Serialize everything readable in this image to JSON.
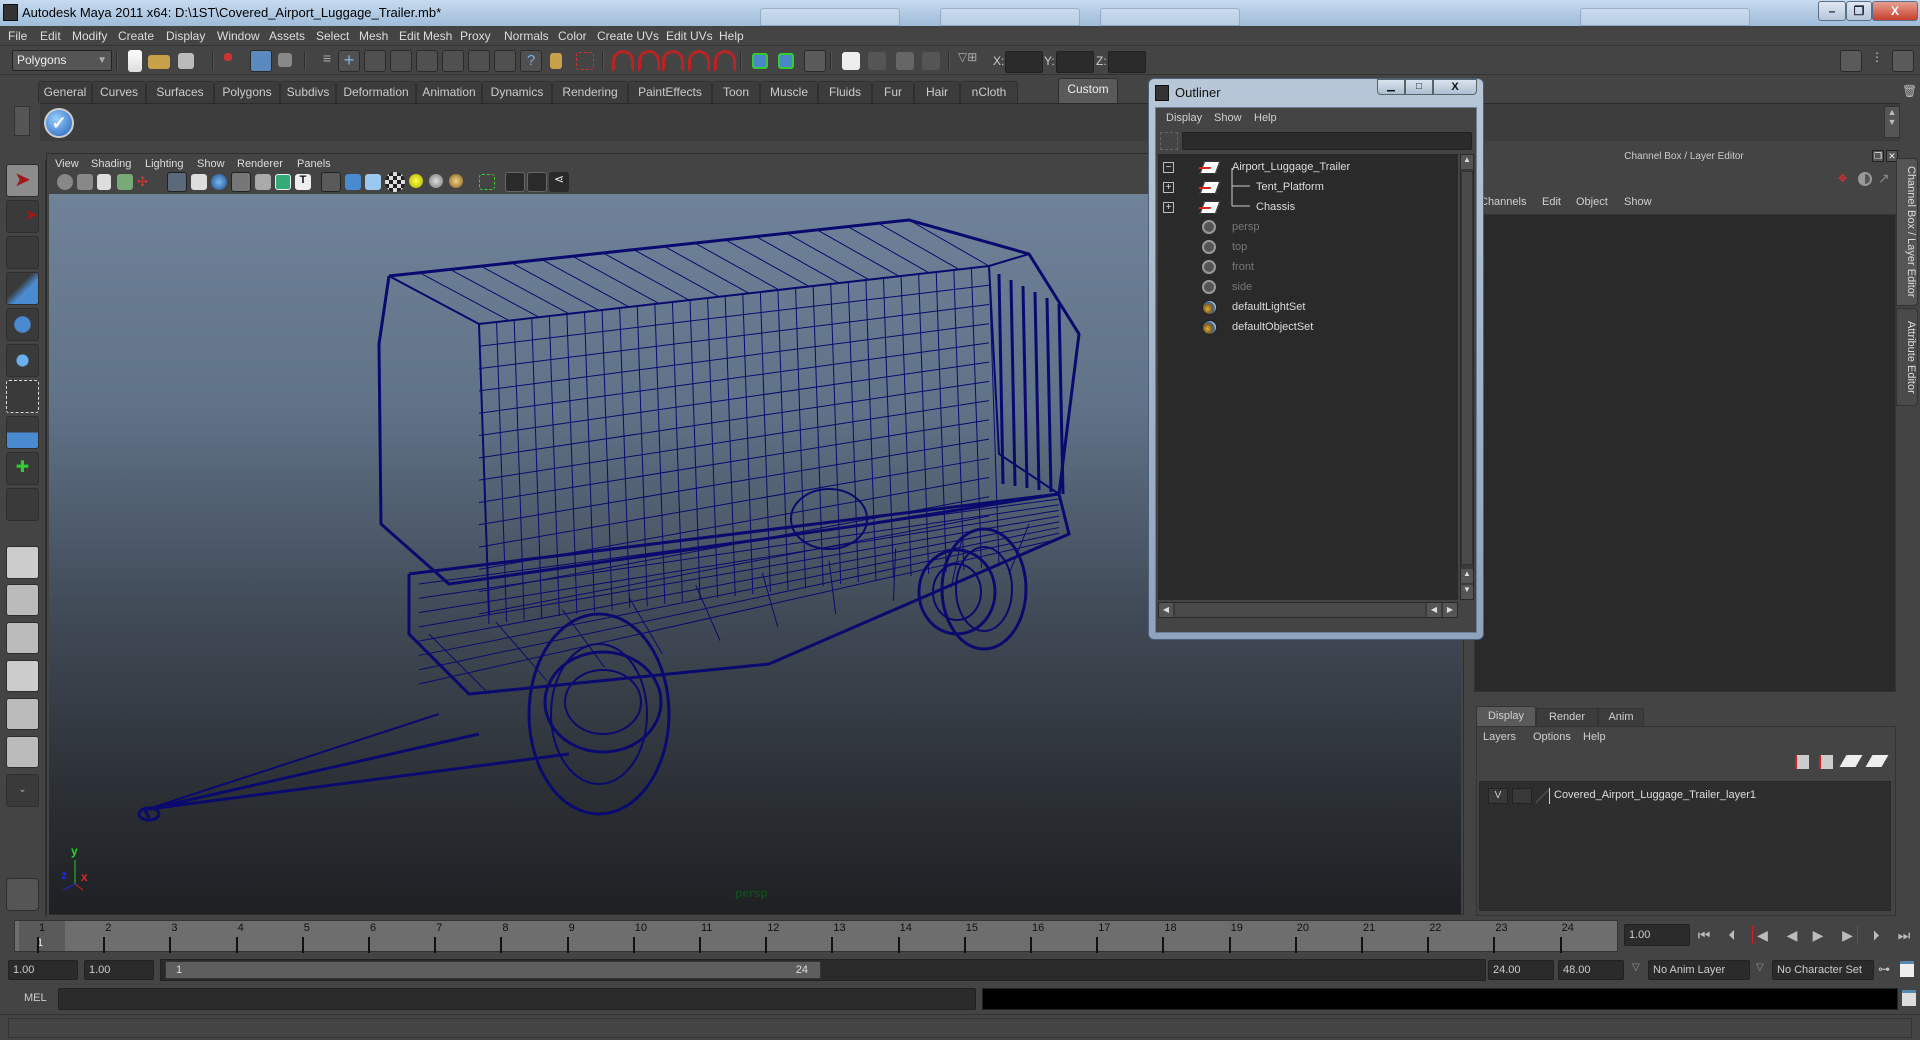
{
  "window": {
    "title": "Autodesk Maya 2011 x64: D:\\1ST\\Covered_Airport_Luggage_Trailer.mb*",
    "controls": {
      "minimize": "–",
      "maximize": "❐",
      "close": "X"
    }
  },
  "menubar": [
    "File",
    "Edit",
    "Modify",
    "Create",
    "Display",
    "Window",
    "Assets",
    "Select",
    "Mesh",
    "Edit Mesh",
    "Proxy",
    "Normals",
    "Color",
    "Create UVs",
    "Edit UVs",
    "Help"
  ],
  "statusline": {
    "menuset": "Polygons",
    "x_label": "X:",
    "y_label": "Y:",
    "z_label": "Z:",
    "x_value": "",
    "y_value": "",
    "z_value": ""
  },
  "shelf": {
    "tabs": [
      "General",
      "Curves",
      "Surfaces",
      "Polygons",
      "Subdivs",
      "Deformation",
      "Animation",
      "Dynamics",
      "Rendering",
      "PaintEffects",
      "Toon",
      "Muscle",
      "Fluids",
      "Fur",
      "Hair",
      "nCloth",
      "Custom"
    ],
    "active_tab": "Custom"
  },
  "viewport": {
    "menu": [
      "View",
      "Shading",
      "Lighting",
      "Show",
      "Renderer",
      "Panels"
    ],
    "camera_label": "persp",
    "axis": {
      "x": "x",
      "y": "y",
      "z": "z"
    },
    "wire_color": "#0a0a6e"
  },
  "outliner": {
    "title": "Outliner",
    "menu": [
      "Display",
      "Show",
      "Help"
    ],
    "filter": "",
    "items": [
      {
        "label": "Airport_Luggage_Trailer",
        "type": "transform",
        "expander": "−",
        "dim": false
      },
      {
        "label": "Tent_Platform",
        "type": "transform",
        "expander": "+",
        "dim": false
      },
      {
        "label": "Chassis",
        "type": "transform",
        "expander": "+",
        "dim": false
      },
      {
        "label": "persp",
        "type": "camera",
        "expander": "",
        "dim": true
      },
      {
        "label": "top",
        "type": "camera",
        "expander": "",
        "dim": true
      },
      {
        "label": "front",
        "type": "camera",
        "expander": "",
        "dim": true
      },
      {
        "label": "side",
        "type": "camera",
        "expander": "",
        "dim": true
      },
      {
        "label": "defaultLightSet",
        "type": "set",
        "expander": "",
        "dim": false
      },
      {
        "label": "defaultObjectSet",
        "type": "set",
        "expander": "",
        "dim": false
      }
    ]
  },
  "channelbox": {
    "title": "Channel Box / Layer Editor",
    "menu": [
      "Channels",
      "Edit",
      "Object",
      "Show"
    ],
    "side_tabs": [
      "Channel Box / Layer Editor",
      "Attribute Editor"
    ]
  },
  "layer_editor": {
    "tabs": [
      "Display",
      "Render",
      "Anim"
    ],
    "active_tab": "Display",
    "menu": [
      "Layers",
      "Options",
      "Help"
    ],
    "layers": [
      {
        "visible": "V",
        "name": "Covered_Airport_Luggage_Trailer_layer1"
      }
    ]
  },
  "timeline": {
    "ticks": [
      "1",
      "2",
      "3",
      "4",
      "5",
      "6",
      "7",
      "8",
      "9",
      "10",
      "11",
      "12",
      "13",
      "14",
      "15",
      "16",
      "17",
      "18",
      "19",
      "20",
      "21",
      "22",
      "23",
      "24"
    ],
    "current_frame_marker": "1",
    "current_time": "1.00",
    "playback": [
      "go-to-start",
      "step-back-key",
      "step-back-frame",
      "play-backward",
      "play-forward",
      "step-forward-frame",
      "step-forward-key",
      "go-to-end"
    ]
  },
  "range": {
    "start_time": "1.00",
    "playback_start": "1.00",
    "slider_start": "1",
    "slider_end": "24",
    "playback_end": "24.00",
    "end_time": "48.00",
    "anim_layer": "No Anim Layer",
    "character_set": "No Character Set"
  },
  "commandline": {
    "label": "MEL",
    "input": "",
    "result": ""
  },
  "helpline": {
    "text": ""
  }
}
